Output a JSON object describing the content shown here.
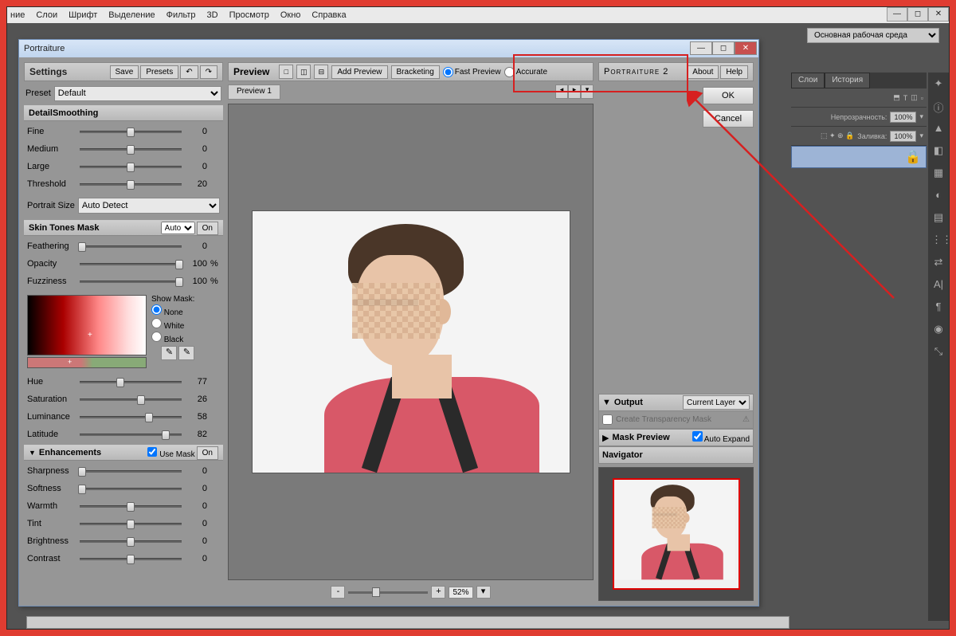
{
  "ps_menu": [
    "ние",
    "Слои",
    "Шрифт",
    "Выделение",
    "Фильтр",
    "3D",
    "Просмотр",
    "Окно",
    "Справка"
  ],
  "workspace": "Основная рабочая среда",
  "layers_panel": {
    "tabs": [
      "Слои",
      "История"
    ],
    "opacity_label": "Непрозрачность:",
    "opacity_value": "100%",
    "fill_label": "Заливка:",
    "fill_value": "100%"
  },
  "dialog": {
    "title": "Portraiture",
    "settings": {
      "header": "Settings",
      "save": "Save",
      "presets": "Presets",
      "preset_label": "Preset",
      "preset_value": "Default",
      "detail": {
        "header": "DetailSmoothing",
        "fine": {
          "label": "Fine",
          "value": 0,
          "pos": 50
        },
        "medium": {
          "label": "Medium",
          "value": 0,
          "pos": 50
        },
        "large": {
          "label": "Large",
          "value": 0,
          "pos": 50
        },
        "threshold": {
          "label": "Threshold",
          "value": 20,
          "pos": 50
        },
        "portrait_size_label": "Portrait Size",
        "portrait_size_value": "Auto Detect"
      },
      "mask": {
        "header": "Skin Tones Mask",
        "mode": "Auto",
        "on": "On",
        "feathering": {
          "label": "Feathering",
          "value": 0,
          "pos": 2
        },
        "opacity": {
          "label": "Opacity",
          "value": 100,
          "pos": 98
        },
        "fuzziness": {
          "label": "Fuzziness",
          "value": 100,
          "pos": 98
        },
        "show_mask": "Show Mask:",
        "none": "None",
        "white": "White",
        "black": "Black",
        "hue": {
          "label": "Hue",
          "value": 77,
          "pos": 40
        },
        "saturation": {
          "label": "Saturation",
          "value": 26,
          "pos": 60
        },
        "luminance": {
          "label": "Luminance",
          "value": 58,
          "pos": 68
        },
        "latitude": {
          "label": "Latitude",
          "value": 82,
          "pos": 84
        }
      },
      "enh": {
        "header": "Enhancements",
        "use_mask": "Use Mask",
        "on": "On",
        "sharpness": {
          "label": "Sharpness",
          "value": 0,
          "pos": 2
        },
        "softness": {
          "label": "Softness",
          "value": 0,
          "pos": 2
        },
        "warmth": {
          "label": "Warmth",
          "value": 0,
          "pos": 50
        },
        "tint": {
          "label": "Tint",
          "value": 0,
          "pos": 50
        },
        "brightness": {
          "label": "Brightness",
          "value": 0,
          "pos": 50
        },
        "contrast": {
          "label": "Contrast",
          "value": 0,
          "pos": 50
        }
      }
    },
    "preview": {
      "header": "Preview",
      "add_preview": "Add Preview",
      "bracketing": "Bracketing",
      "fast": "Fast Preview",
      "accurate": "Accurate",
      "tab": "Preview 1",
      "zoom": "52%"
    },
    "right": {
      "brand": "Portraiture 2",
      "about": "About",
      "help": "Help",
      "ok": "OK",
      "cancel": "Cancel",
      "output": "Output",
      "output_mode": "Current Layer",
      "create_transp": "Create Transparency Mask",
      "mask_preview": "Mask Preview",
      "auto_expand": "Auto Expand",
      "navigator": "Navigator"
    }
  }
}
